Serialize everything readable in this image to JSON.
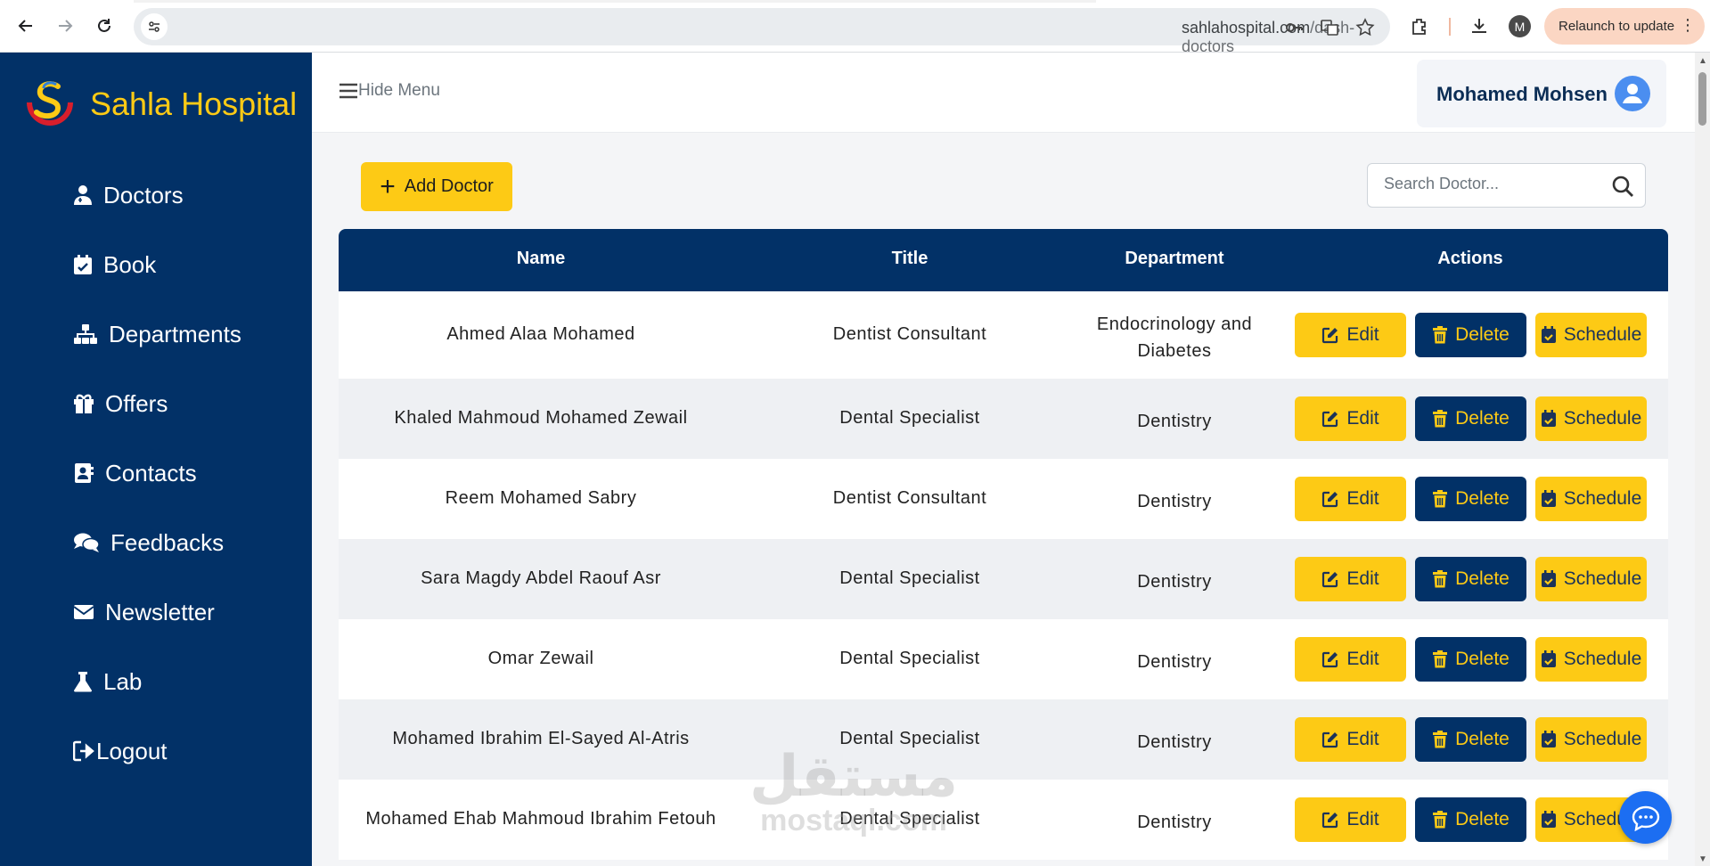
{
  "browser": {
    "url_host": "sahlahospital.com",
    "url_path": "/dash-doctors",
    "profile_initial": "M",
    "relaunch_label": "Relaunch to update",
    "menu_dots": "⋮"
  },
  "sidebar": {
    "brand": "Sahla Hospital",
    "items": [
      {
        "label": "Doctors",
        "icon": "user-doctor-icon"
      },
      {
        "label": "Book",
        "icon": "calendar-check-icon"
      },
      {
        "label": "Departments",
        "icon": "sitemap-icon"
      },
      {
        "label": "Offers",
        "icon": "gift-icon"
      },
      {
        "label": "Contacts",
        "icon": "address-book-icon"
      },
      {
        "label": "Feedbacks",
        "icon": "comments-icon"
      },
      {
        "label": "Newsletter",
        "icon": "envelope-icon"
      },
      {
        "label": "Lab",
        "icon": "flask-icon"
      },
      {
        "label": "Logout",
        "icon": "logout-icon"
      }
    ]
  },
  "topbar": {
    "hide_menu_label": "Hide Menu",
    "user_name": "Mohamed Mohsen"
  },
  "toolbar": {
    "add_label": "Add Doctor",
    "search_placeholder": "Search Doctor..."
  },
  "table": {
    "columns": [
      "Name",
      "Title",
      "Department",
      "Actions"
    ],
    "actions": {
      "edit": "Edit",
      "delete": "Delete",
      "schedule": "Schedule"
    },
    "rows": [
      {
        "name": "Ahmed Alaa Mohamed",
        "title": "Dentist Consultant",
        "department_line1": "Endocrinology and",
        "department_line2": "Diabetes"
      },
      {
        "name": "Khaled Mahmoud Mohamed Zewail",
        "title": "Dental Specialist",
        "department_line1": "Dentistry",
        "department_line2": ""
      },
      {
        "name": "Reem Mohamed Sabry",
        "title": "Dentist Consultant",
        "department_line1": "Dentistry",
        "department_line2": ""
      },
      {
        "name": "Sara Magdy Abdel Raouf Asr",
        "title": "Dental Specialist",
        "department_line1": "Dentistry",
        "department_line2": ""
      },
      {
        "name": "Omar Zewail",
        "title": "Dental Specialist",
        "department_line1": "Dentistry",
        "department_line2": ""
      },
      {
        "name": "Mohamed Ibrahim El-Sayed Al-Atris",
        "title": "Dental Specialist",
        "department_line1": "Dentistry",
        "department_line2": ""
      },
      {
        "name": "Mohamed Ehab Mahmoud Ibrahim Fetouh",
        "title": "Dental Specialist",
        "department_line1": "Dentistry",
        "department_line2": ""
      }
    ]
  },
  "watermark": {
    "arabic": "مستقل",
    "latin": "mostaql.com"
  },
  "colors": {
    "navy": "#023167",
    "yellow": "#fdca15",
    "row_alt": "#eef0f3"
  }
}
